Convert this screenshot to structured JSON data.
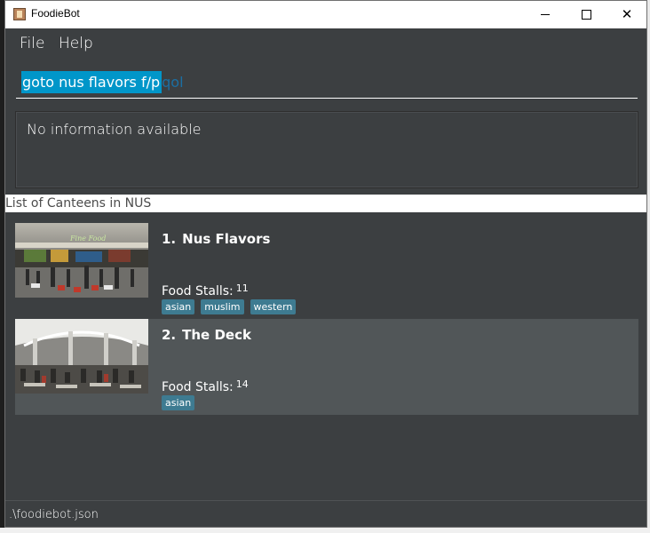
{
  "window": {
    "title": "FoodieBot",
    "app_icon": "foodiebot-app-icon",
    "controls": {
      "minimize_icon": "minimize-icon",
      "maximize_icon": "maximize-icon",
      "close_icon": "close-icon",
      "close_glyph": "✕"
    }
  },
  "menu": {
    "file": "File",
    "help": "Help"
  },
  "command": {
    "selected_text": "goto nus flavors f/p",
    "ghost_text": "qol"
  },
  "result": {
    "text": "No information available"
  },
  "list": {
    "header": "List of Canteens in NUS",
    "canteens": [
      {
        "index": "1.",
        "name": "Nus Flavors",
        "stalls_label": "Food Stalls:",
        "stalls_count": "11",
        "tags": [
          "asian",
          "muslim",
          "western"
        ],
        "image": "canteen-photo-fine-food",
        "sign_text": "Fine Food"
      },
      {
        "index": "2.",
        "name": "The Deck",
        "stalls_label": "Food Stalls:",
        "stalls_count": "14",
        "tags": [
          "asian"
        ],
        "image": "canteen-photo-the-deck"
      }
    ]
  },
  "status": {
    "file_path": ".\\foodiebot.json"
  },
  "colors": {
    "selection": "#0096c9",
    "tag": "#3e7b91",
    "panel": "#3c3f41",
    "selected_card": "#515658"
  }
}
